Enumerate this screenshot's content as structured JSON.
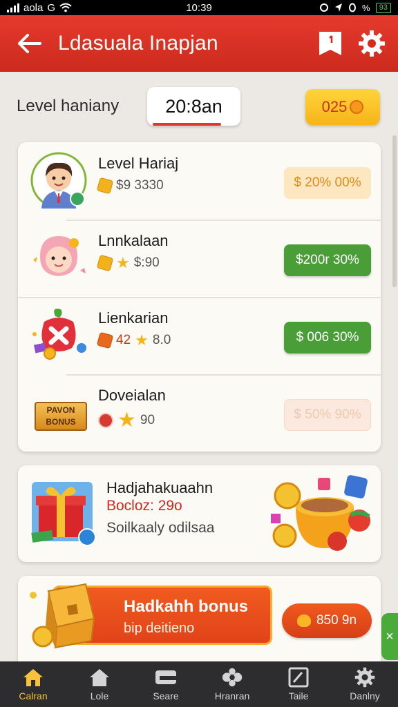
{
  "status_bar": {
    "carrier": "aola",
    "network": "G",
    "time": "10:39",
    "battery": "93"
  },
  "header": {
    "title": "Ldasuala Inapjan"
  },
  "level": {
    "label": "Level haniany",
    "value": "20:8an",
    "coins": "025"
  },
  "tasks": [
    {
      "title": "Level  Hariaj",
      "meta_text": "$9 3330",
      "reward": "$ 20% 00%",
      "style": "pale"
    },
    {
      "title": "Lnnkalaan",
      "meta_text": "$:90",
      "reward": "$200r 30%",
      "style": "green"
    },
    {
      "title": "Lienkarian",
      "meta_prefix": "42",
      "meta_text": "8.0",
      "reward": "$ 006 30%",
      "style": "green"
    },
    {
      "title": "Doveialan",
      "badge_line1": "PAVON",
      "badge_line2": "BONUS",
      "meta_text": "90",
      "reward": "$ 50% 90%",
      "style": "faded"
    }
  ],
  "promo": {
    "title": "Hadjahakuaahn",
    "subtitle": "Bocloz: 29o",
    "description": "Soilkaaly odilsaa"
  },
  "bonus": {
    "title": "Hadkahh bonus",
    "subtitle": "bip deitieno",
    "button": "850 9n"
  },
  "side_tab": {
    "label": "×"
  },
  "nav": [
    {
      "label": "Calran",
      "icon": "home-icon",
      "active": true
    },
    {
      "label": "Lole",
      "icon": "house-icon",
      "active": false
    },
    {
      "label": "Seare",
      "icon": "store-icon",
      "active": false
    },
    {
      "label": "Hranran",
      "icon": "gamepad-icon",
      "active": false
    },
    {
      "label": "Taile",
      "icon": "chart-icon",
      "active": false
    },
    {
      "label": "Danlny",
      "icon": "gear-icon",
      "active": false
    }
  ],
  "colors": {
    "header_red": "#e0362a",
    "green": "#4a9e38",
    "gold": "#f6b41a",
    "nav_bg": "#2d2d2f",
    "nav_active": "#f5c23a"
  }
}
